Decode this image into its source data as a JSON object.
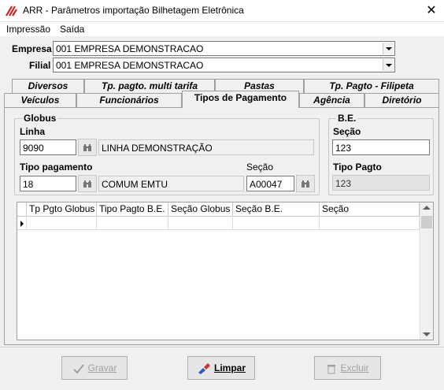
{
  "window": {
    "title": "ARR - Parâmetros importação Bilhetagem Eletrônica",
    "close_label": "✕"
  },
  "menu": {
    "items": [
      "Impressão",
      "Saída"
    ]
  },
  "empresa": {
    "label": "Empresa",
    "value": "001 EMPRESA DEMONSTRACAO"
  },
  "filial": {
    "label": "Filial",
    "value": "001 EMPRESA DEMONSTRACAO"
  },
  "tabs": {
    "row1": [
      "Diversos",
      "Tp. pagto. multi tarifa",
      "Pastas",
      "Tp. Pagto - Filipeta"
    ],
    "row2": [
      "Veículos",
      "Funcionários",
      "Tipos de Pagamento",
      "Agência",
      "Diretório"
    ]
  },
  "globus": {
    "title": "Globus",
    "linha_label": "Linha",
    "linha_code": "9090",
    "linha_desc": "LINHA DEMONSTRAÇÃO",
    "tipo_label": "Tipo pagamento",
    "tipo_code": "18",
    "tipo_desc": "COMUM EMTU",
    "secao_label": "Seção",
    "secao_value": "A00047"
  },
  "be": {
    "title": "B.E.",
    "secao_label": "Seção",
    "secao_value": "123",
    "tipo_label": "Tipo Pagto",
    "tipo_value": "123"
  },
  "grid": {
    "columns": [
      "Tp Pgto Globus",
      "Tipo Pagto B.E.",
      "Seção Globus",
      "Seção B.E.",
      "Seção"
    ]
  },
  "buttons": {
    "gravar": "Gravar",
    "limpar": "Limpar",
    "excluir": "Excluir"
  },
  "colors": {
    "accent": "#cc2222"
  }
}
